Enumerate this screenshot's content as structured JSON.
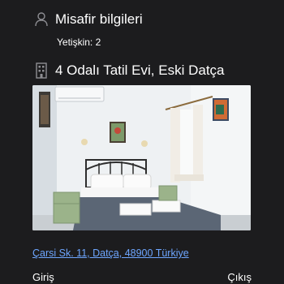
{
  "guests": {
    "icon": "person-icon",
    "title": "Misafir bilgileri",
    "adults": "Yetişkin: 2"
  },
  "hotel": {
    "icon": "building-icon",
    "name": "4 Odalı Tatil Evi, Eski Datça",
    "photo": "room-photo",
    "address": "Çarsi Sk. 11, Datça, 48900 Türkiye"
  },
  "dates": {
    "checkin_label": "Giriş",
    "checkout_label": "Çıkış"
  },
  "colors": {
    "background": "#1c1c1e",
    "text": "#ffffff",
    "link": "#6ea6ff"
  }
}
